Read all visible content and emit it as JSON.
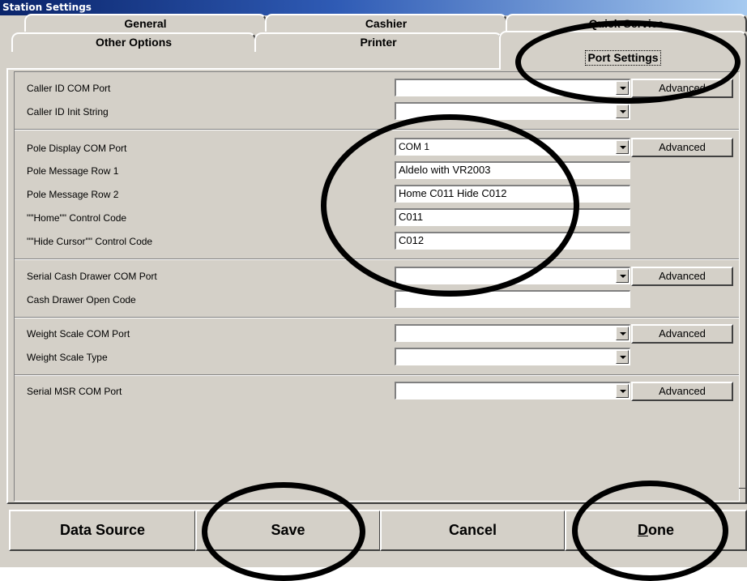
{
  "window": {
    "title": "Station Settings"
  },
  "tabs": {
    "row1": [
      "General",
      "Cashier",
      "Quick Service"
    ],
    "row2": [
      "Other Options",
      "Printer",
      "Port Settings"
    ],
    "active": "Port Settings"
  },
  "labels": {
    "caller_id_com_port": "Caller ID COM Port",
    "caller_id_init_string": "Caller ID Init String",
    "pole_display_com_port": "Pole Display COM Port",
    "pole_message_row_1": "Pole Message Row 1",
    "pole_message_row_2": "Pole Message Row 2",
    "home_control_code": "\"\"Home\"\" Control Code",
    "hide_cursor_control_code": "\"\"Hide Cursor\"\" Control Code",
    "serial_cash_drawer_com_port": "Serial Cash Drawer COM Port",
    "cash_drawer_open_code": "Cash Drawer Open Code",
    "weight_scale_com_port": "Weight Scale COM Port",
    "weight_scale_type": "Weight Scale Type",
    "serial_msr_com_port": "Serial MSR COM Port"
  },
  "values": {
    "caller_id_com_port": "",
    "caller_id_init_string": "",
    "pole_display_com_port": "COM 1",
    "pole_message_row_1": "Aldelo with VR2003",
    "pole_message_row_2": "Home C011 Hide C012",
    "home_control_code": "C011",
    "hide_cursor_control_code": "C012",
    "serial_cash_drawer_com_port": "",
    "cash_drawer_open_code": "",
    "weight_scale_com_port": "",
    "weight_scale_type": "",
    "serial_msr_com_port": ""
  },
  "advanced_label": "Advanced",
  "buttons": {
    "data_source": "Data Source",
    "save": "Save",
    "cancel": "Cancel",
    "done_mnemonic": "D",
    "done_rest": "one"
  }
}
